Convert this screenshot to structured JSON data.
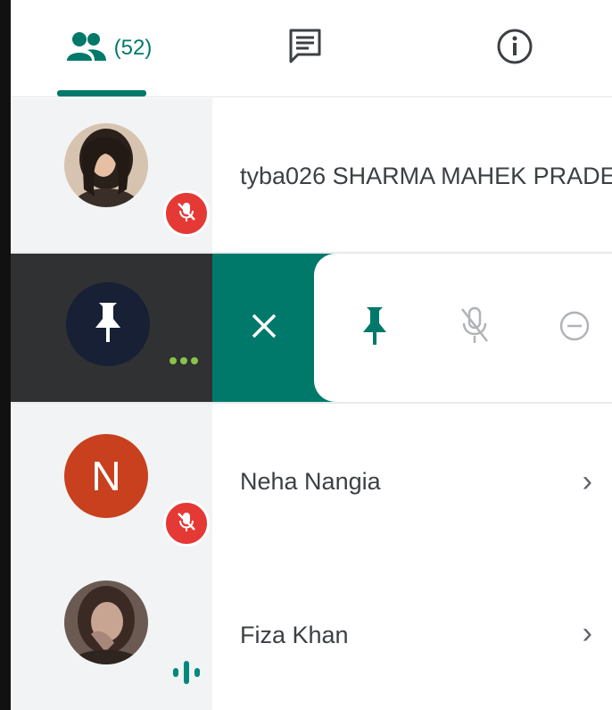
{
  "tabs": {
    "people_count": "(52)",
    "people_icon": "people-icon",
    "chat_icon": "chat-icon",
    "info_icon": "info-icon"
  },
  "participants": [
    {
      "name": "tyba026 SHARMA MAHEK PRADE...",
      "avatar": "photo",
      "status": "muted"
    },
    {
      "name": "",
      "avatar": "pin-icon",
      "status": "options-open",
      "actions": [
        "close-icon",
        "pin-icon",
        "mic-off-icon",
        "remove-icon"
      ]
    },
    {
      "name": "Neha Nangia",
      "avatar_letter": "N",
      "status": "muted"
    },
    {
      "name": "Fiza Khan",
      "avatar": "photo",
      "status": "speaking"
    }
  ],
  "colors": {
    "accent": "#00796b",
    "muted_badge": "#e53935",
    "avatar_letter_bg": "#c8401e",
    "speaking": "#00897b",
    "dark_panel": "#2f3133"
  }
}
